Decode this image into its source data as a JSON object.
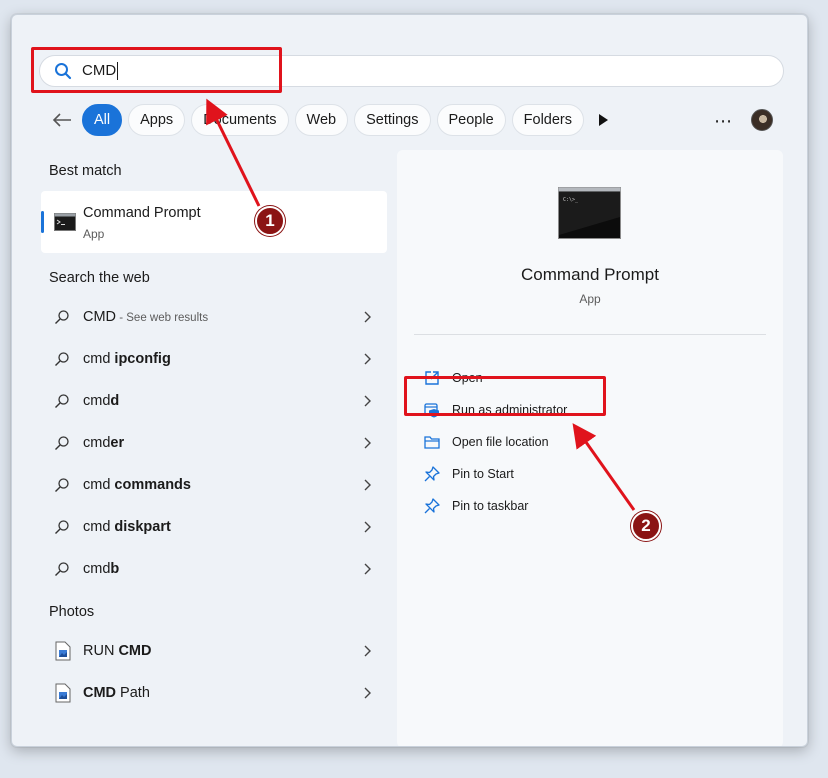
{
  "search": {
    "query": "CMD"
  },
  "filters": {
    "items": [
      "All",
      "Apps",
      "Documents",
      "Web",
      "Settings",
      "People",
      "Folders"
    ]
  },
  "best_match": {
    "heading": "Best match",
    "title": "Command Prompt",
    "subtitle": "App"
  },
  "web": {
    "heading": "Search the web",
    "items": [
      {
        "prefix": "CMD",
        "bold": "",
        "hint": " - See web results"
      },
      {
        "prefix": "cmd ",
        "bold": "ipconfig",
        "hint": ""
      },
      {
        "prefix": "cmd",
        "bold": "d",
        "hint": ""
      },
      {
        "prefix": "cmd",
        "bold": "er",
        "hint": ""
      },
      {
        "prefix": "cmd ",
        "bold": "commands",
        "hint": ""
      },
      {
        "prefix": "cmd ",
        "bold": "diskpart",
        "hint": ""
      },
      {
        "prefix": "cmd",
        "bold": "b",
        "hint": ""
      }
    ]
  },
  "photos": {
    "heading": "Photos",
    "items": [
      {
        "prefix": "RUN ",
        "bold": "CMD",
        "suffix": ""
      },
      {
        "prefix": "",
        "bold": "CMD",
        "suffix": " Path"
      }
    ]
  },
  "detail": {
    "title": "Command Prompt",
    "subtitle": "App",
    "actions": [
      "Open",
      "Run as administrator",
      "Open file location",
      "Pin to Start",
      "Pin to taskbar"
    ]
  },
  "annotations": {
    "step1": "1",
    "step2": "2"
  },
  "colors": {
    "accent": "#1a73d9",
    "highlight": "#e0131c",
    "badge": "#8b1414"
  }
}
